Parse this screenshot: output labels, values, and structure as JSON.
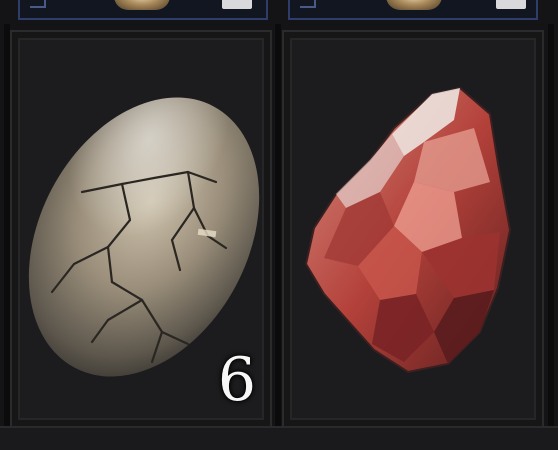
{
  "inventory": {
    "slots": [
      {
        "item": "cracked-stone-egg",
        "count": "6",
        "icon": "cracked-egg-icon"
      },
      {
        "item": "red-crystal",
        "count": "",
        "icon": "red-crystal-icon"
      }
    ]
  },
  "colors": {
    "slot_background": "#1c1c1e",
    "top_slot_border": "#2f3d6b",
    "stack_count_text": "#f7f7f7"
  }
}
